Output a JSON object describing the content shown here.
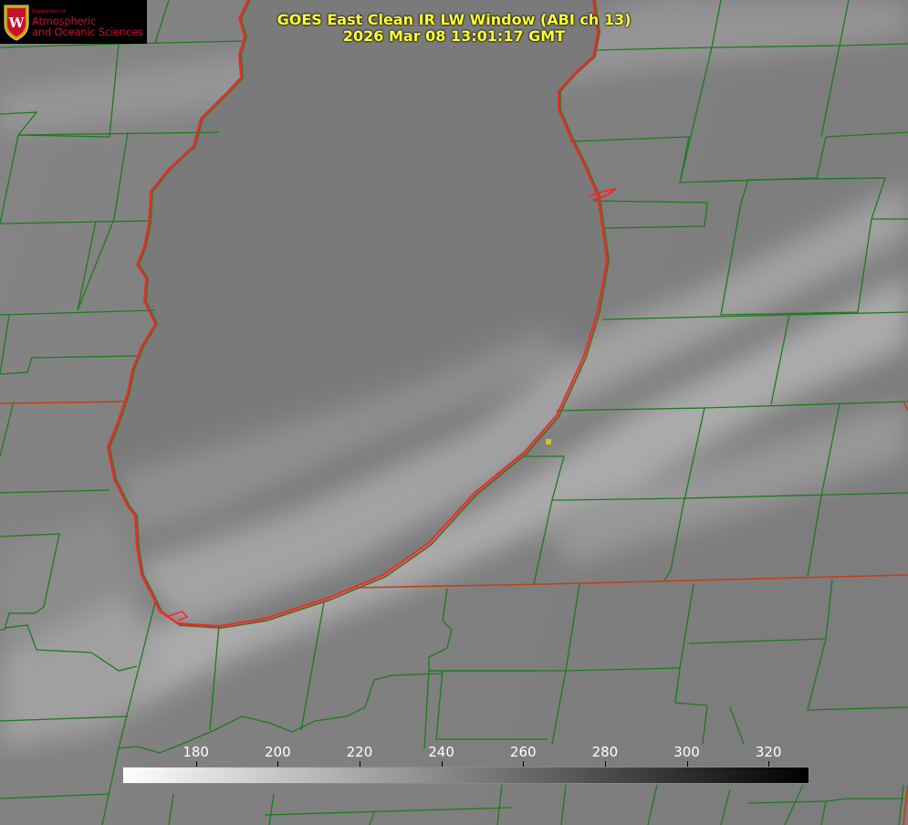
{
  "title": {
    "line1": "GOES East Clean IR LW Window (ABI ch 13)",
    "line2": "2026 Mar 08 13:01:17 GMT"
  },
  "logo": {
    "department": "Department of",
    "line1": "Atmospheric",
    "line2": "and Oceanic Sciences",
    "crest_letter": "W"
  },
  "colorbar": {
    "min": 162,
    "max": 330,
    "ticks": [
      "180",
      "200",
      "220",
      "240",
      "260",
      "280",
      "300",
      "320"
    ],
    "gradient": "white-to-black"
  },
  "colors": {
    "title": "#ffff33",
    "county_lines": "#1e7a1e",
    "coastline": "#ff2222",
    "state_lines": "#ff5522",
    "marker": "#d4c21a",
    "logo_red": "#c8102e"
  }
}
